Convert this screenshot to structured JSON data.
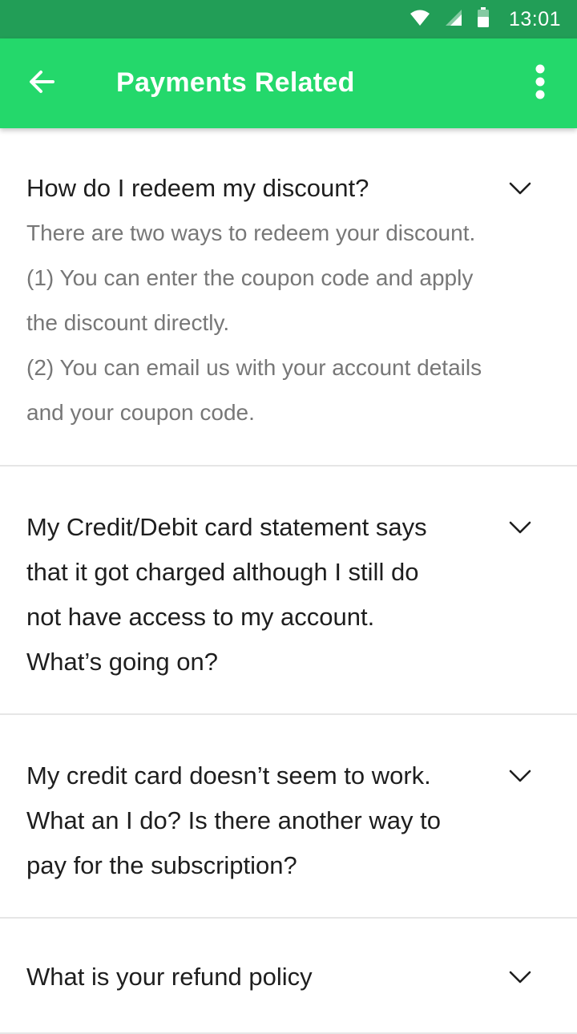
{
  "status_bar": {
    "time": "13:01",
    "icons": [
      "wifi-icon",
      "cell-signal-icon",
      "battery-icon"
    ]
  },
  "app_bar": {
    "title": "Payments Related",
    "back_icon": "arrow-left-icon",
    "menu_icon": "more-vertical-icon",
    "color": "#24d86b"
  },
  "faqs": [
    {
      "question": "How do I redeem my discount?",
      "expanded": true,
      "answer_lines": [
        "There are two ways to redeem your discount.",
        "(1) You can enter the coupon code and apply",
        "the discount directly.",
        "(2) You can email us with your account details",
        "and your coupon code."
      ]
    },
    {
      "question": "My Credit/Debit card statement says that it got charged although I still do not have access to my account. What’s going on?",
      "question_lines": [
        "My Credit/Debit card statement says",
        "that it got charged although I still do",
        "not have access to my account.",
        "What’s going on?"
      ],
      "expanded": false
    },
    {
      "question": "My credit card doesn’t seem to work. What an I do? Is there another way to pay for the subscription?",
      "question_lines": [
        "My credit card doesn’t seem to work.",
        "What an I do? Is there another way to",
        "pay for the subscription?"
      ],
      "expanded": false
    },
    {
      "question": "What is your refund policy",
      "expanded": false
    }
  ],
  "colors": {
    "status_bar": "#229e57",
    "app_bar": "#24d86b",
    "question_text": "#1e1e1e",
    "answer_text": "#777777",
    "divider": "#e6e6e6"
  }
}
